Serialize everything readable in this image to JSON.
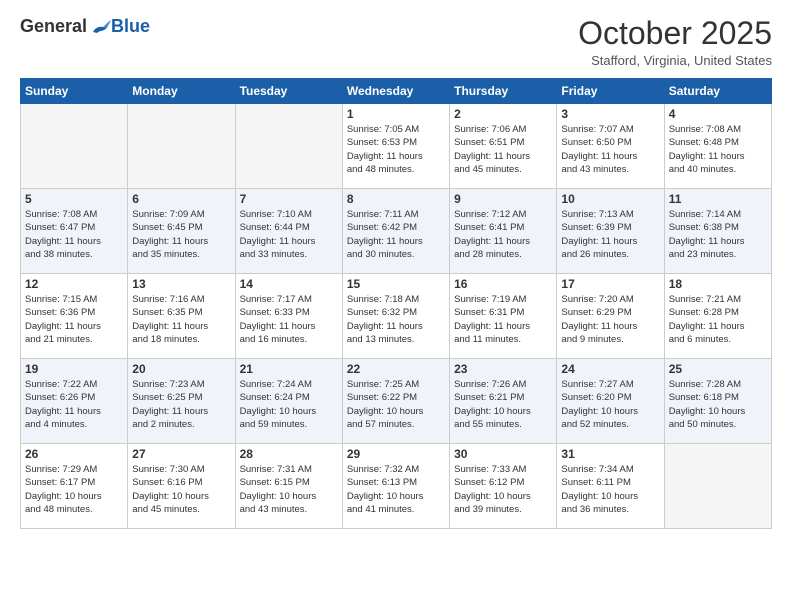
{
  "logo": {
    "general": "General",
    "blue": "Blue"
  },
  "header": {
    "month": "October 2025",
    "location": "Stafford, Virginia, United States"
  },
  "days_of_week": [
    "Sunday",
    "Monday",
    "Tuesday",
    "Wednesday",
    "Thursday",
    "Friday",
    "Saturday"
  ],
  "weeks": [
    [
      {
        "day": "",
        "info": ""
      },
      {
        "day": "",
        "info": ""
      },
      {
        "day": "",
        "info": ""
      },
      {
        "day": "1",
        "info": "Sunrise: 7:05 AM\nSunset: 6:53 PM\nDaylight: 11 hours\nand 48 minutes."
      },
      {
        "day": "2",
        "info": "Sunrise: 7:06 AM\nSunset: 6:51 PM\nDaylight: 11 hours\nand 45 minutes."
      },
      {
        "day": "3",
        "info": "Sunrise: 7:07 AM\nSunset: 6:50 PM\nDaylight: 11 hours\nand 43 minutes."
      },
      {
        "day": "4",
        "info": "Sunrise: 7:08 AM\nSunset: 6:48 PM\nDaylight: 11 hours\nand 40 minutes."
      }
    ],
    [
      {
        "day": "5",
        "info": "Sunrise: 7:08 AM\nSunset: 6:47 PM\nDaylight: 11 hours\nand 38 minutes."
      },
      {
        "day": "6",
        "info": "Sunrise: 7:09 AM\nSunset: 6:45 PM\nDaylight: 11 hours\nand 35 minutes."
      },
      {
        "day": "7",
        "info": "Sunrise: 7:10 AM\nSunset: 6:44 PM\nDaylight: 11 hours\nand 33 minutes."
      },
      {
        "day": "8",
        "info": "Sunrise: 7:11 AM\nSunset: 6:42 PM\nDaylight: 11 hours\nand 30 minutes."
      },
      {
        "day": "9",
        "info": "Sunrise: 7:12 AM\nSunset: 6:41 PM\nDaylight: 11 hours\nand 28 minutes."
      },
      {
        "day": "10",
        "info": "Sunrise: 7:13 AM\nSunset: 6:39 PM\nDaylight: 11 hours\nand 26 minutes."
      },
      {
        "day": "11",
        "info": "Sunrise: 7:14 AM\nSunset: 6:38 PM\nDaylight: 11 hours\nand 23 minutes."
      }
    ],
    [
      {
        "day": "12",
        "info": "Sunrise: 7:15 AM\nSunset: 6:36 PM\nDaylight: 11 hours\nand 21 minutes."
      },
      {
        "day": "13",
        "info": "Sunrise: 7:16 AM\nSunset: 6:35 PM\nDaylight: 11 hours\nand 18 minutes."
      },
      {
        "day": "14",
        "info": "Sunrise: 7:17 AM\nSunset: 6:33 PM\nDaylight: 11 hours\nand 16 minutes."
      },
      {
        "day": "15",
        "info": "Sunrise: 7:18 AM\nSunset: 6:32 PM\nDaylight: 11 hours\nand 13 minutes."
      },
      {
        "day": "16",
        "info": "Sunrise: 7:19 AM\nSunset: 6:31 PM\nDaylight: 11 hours\nand 11 minutes."
      },
      {
        "day": "17",
        "info": "Sunrise: 7:20 AM\nSunset: 6:29 PM\nDaylight: 11 hours\nand 9 minutes."
      },
      {
        "day": "18",
        "info": "Sunrise: 7:21 AM\nSunset: 6:28 PM\nDaylight: 11 hours\nand 6 minutes."
      }
    ],
    [
      {
        "day": "19",
        "info": "Sunrise: 7:22 AM\nSunset: 6:26 PM\nDaylight: 11 hours\nand 4 minutes."
      },
      {
        "day": "20",
        "info": "Sunrise: 7:23 AM\nSunset: 6:25 PM\nDaylight: 11 hours\nand 2 minutes."
      },
      {
        "day": "21",
        "info": "Sunrise: 7:24 AM\nSunset: 6:24 PM\nDaylight: 10 hours\nand 59 minutes."
      },
      {
        "day": "22",
        "info": "Sunrise: 7:25 AM\nSunset: 6:22 PM\nDaylight: 10 hours\nand 57 minutes."
      },
      {
        "day": "23",
        "info": "Sunrise: 7:26 AM\nSunset: 6:21 PM\nDaylight: 10 hours\nand 55 minutes."
      },
      {
        "day": "24",
        "info": "Sunrise: 7:27 AM\nSunset: 6:20 PM\nDaylight: 10 hours\nand 52 minutes."
      },
      {
        "day": "25",
        "info": "Sunrise: 7:28 AM\nSunset: 6:18 PM\nDaylight: 10 hours\nand 50 minutes."
      }
    ],
    [
      {
        "day": "26",
        "info": "Sunrise: 7:29 AM\nSunset: 6:17 PM\nDaylight: 10 hours\nand 48 minutes."
      },
      {
        "day": "27",
        "info": "Sunrise: 7:30 AM\nSunset: 6:16 PM\nDaylight: 10 hours\nand 45 minutes."
      },
      {
        "day": "28",
        "info": "Sunrise: 7:31 AM\nSunset: 6:15 PM\nDaylight: 10 hours\nand 43 minutes."
      },
      {
        "day": "29",
        "info": "Sunrise: 7:32 AM\nSunset: 6:13 PM\nDaylight: 10 hours\nand 41 minutes."
      },
      {
        "day": "30",
        "info": "Sunrise: 7:33 AM\nSunset: 6:12 PM\nDaylight: 10 hours\nand 39 minutes."
      },
      {
        "day": "31",
        "info": "Sunrise: 7:34 AM\nSunset: 6:11 PM\nDaylight: 10 hours\nand 36 minutes."
      },
      {
        "day": "",
        "info": ""
      }
    ]
  ]
}
